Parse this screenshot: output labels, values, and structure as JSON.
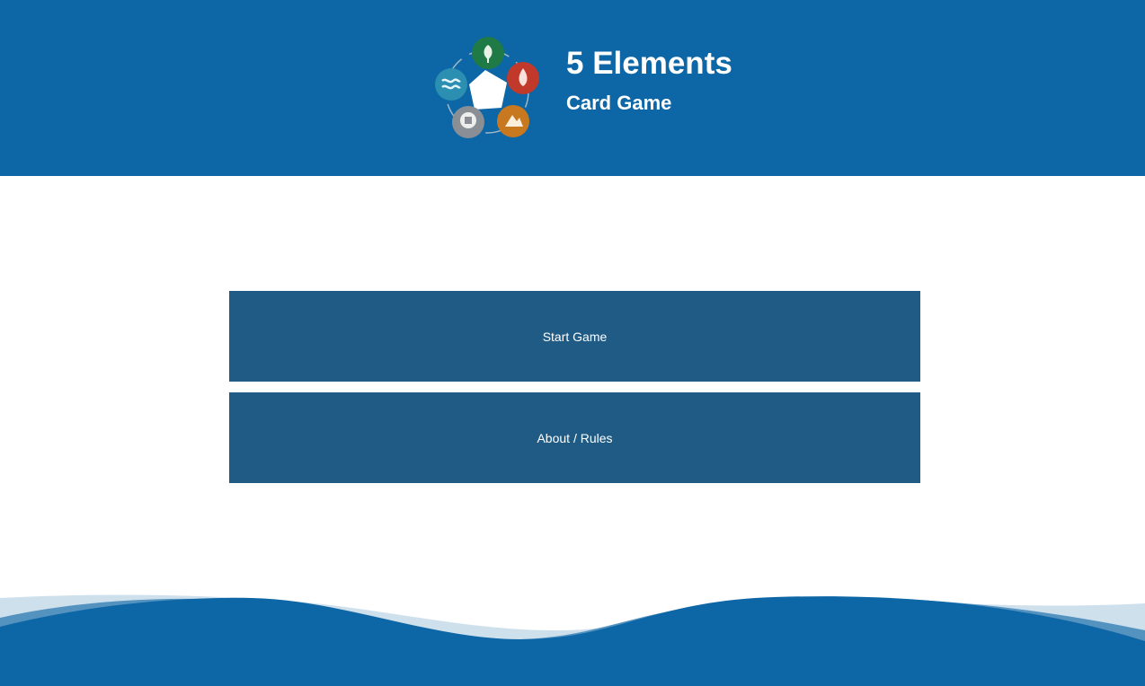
{
  "header": {
    "title": "5 Elements",
    "subtitle": "Card Game",
    "logo_icon": "five-elements-cycle-icon",
    "background_color": "#0d66a5"
  },
  "menu": {
    "buttons": [
      {
        "label": "Start Game"
      },
      {
        "label": "About / Rules"
      }
    ],
    "button_color": "#1f5b84"
  },
  "footer": {
    "decoration_icon": "waves-icon",
    "colors": [
      "#cfe0ed",
      "#5493c0",
      "#0d66a5"
    ]
  }
}
